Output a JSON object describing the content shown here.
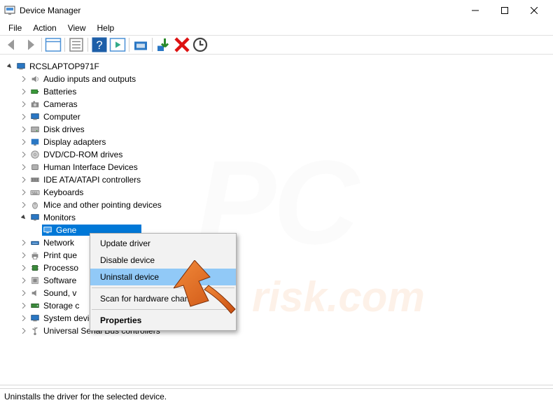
{
  "window": {
    "title": "Device Manager"
  },
  "menu": {
    "file": "File",
    "action": "Action",
    "view": "View",
    "help": "Help"
  },
  "tree": {
    "root_label": "RCSLAPTOP971F",
    "audio": "Audio inputs and outputs",
    "batteries": "Batteries",
    "cameras": "Cameras",
    "computer": "Computer",
    "disk_drives": "Disk drives",
    "display_adapters": "Display adapters",
    "dvd": "DVD/CD-ROM drives",
    "hid": "Human Interface Devices",
    "ide": "IDE ATA/ATAPI controllers",
    "keyboards": "Keyboards",
    "mice": "Mice and other pointing devices",
    "monitors": "Monitors",
    "monitors_child": "Gene",
    "network": "Network",
    "print_queues": "Print que",
    "processors": "Processo",
    "software": "Software",
    "sound": "Sound, v",
    "storage": "Storage c",
    "system": "System devices",
    "usb": "Universal Serial Bus controllers"
  },
  "context_menu": {
    "update_driver": "Update driver",
    "disable_device": "Disable device",
    "uninstall_device": "Uninstall device",
    "scan_hardware": "Scan for hardware changes",
    "properties": "Properties"
  },
  "status": {
    "text": "Uninstalls the driver for the selected device."
  },
  "colors": {
    "selection": "#0078d7",
    "context_highlight": "#91c9f7",
    "cursor_arrow": "#e65c18"
  }
}
